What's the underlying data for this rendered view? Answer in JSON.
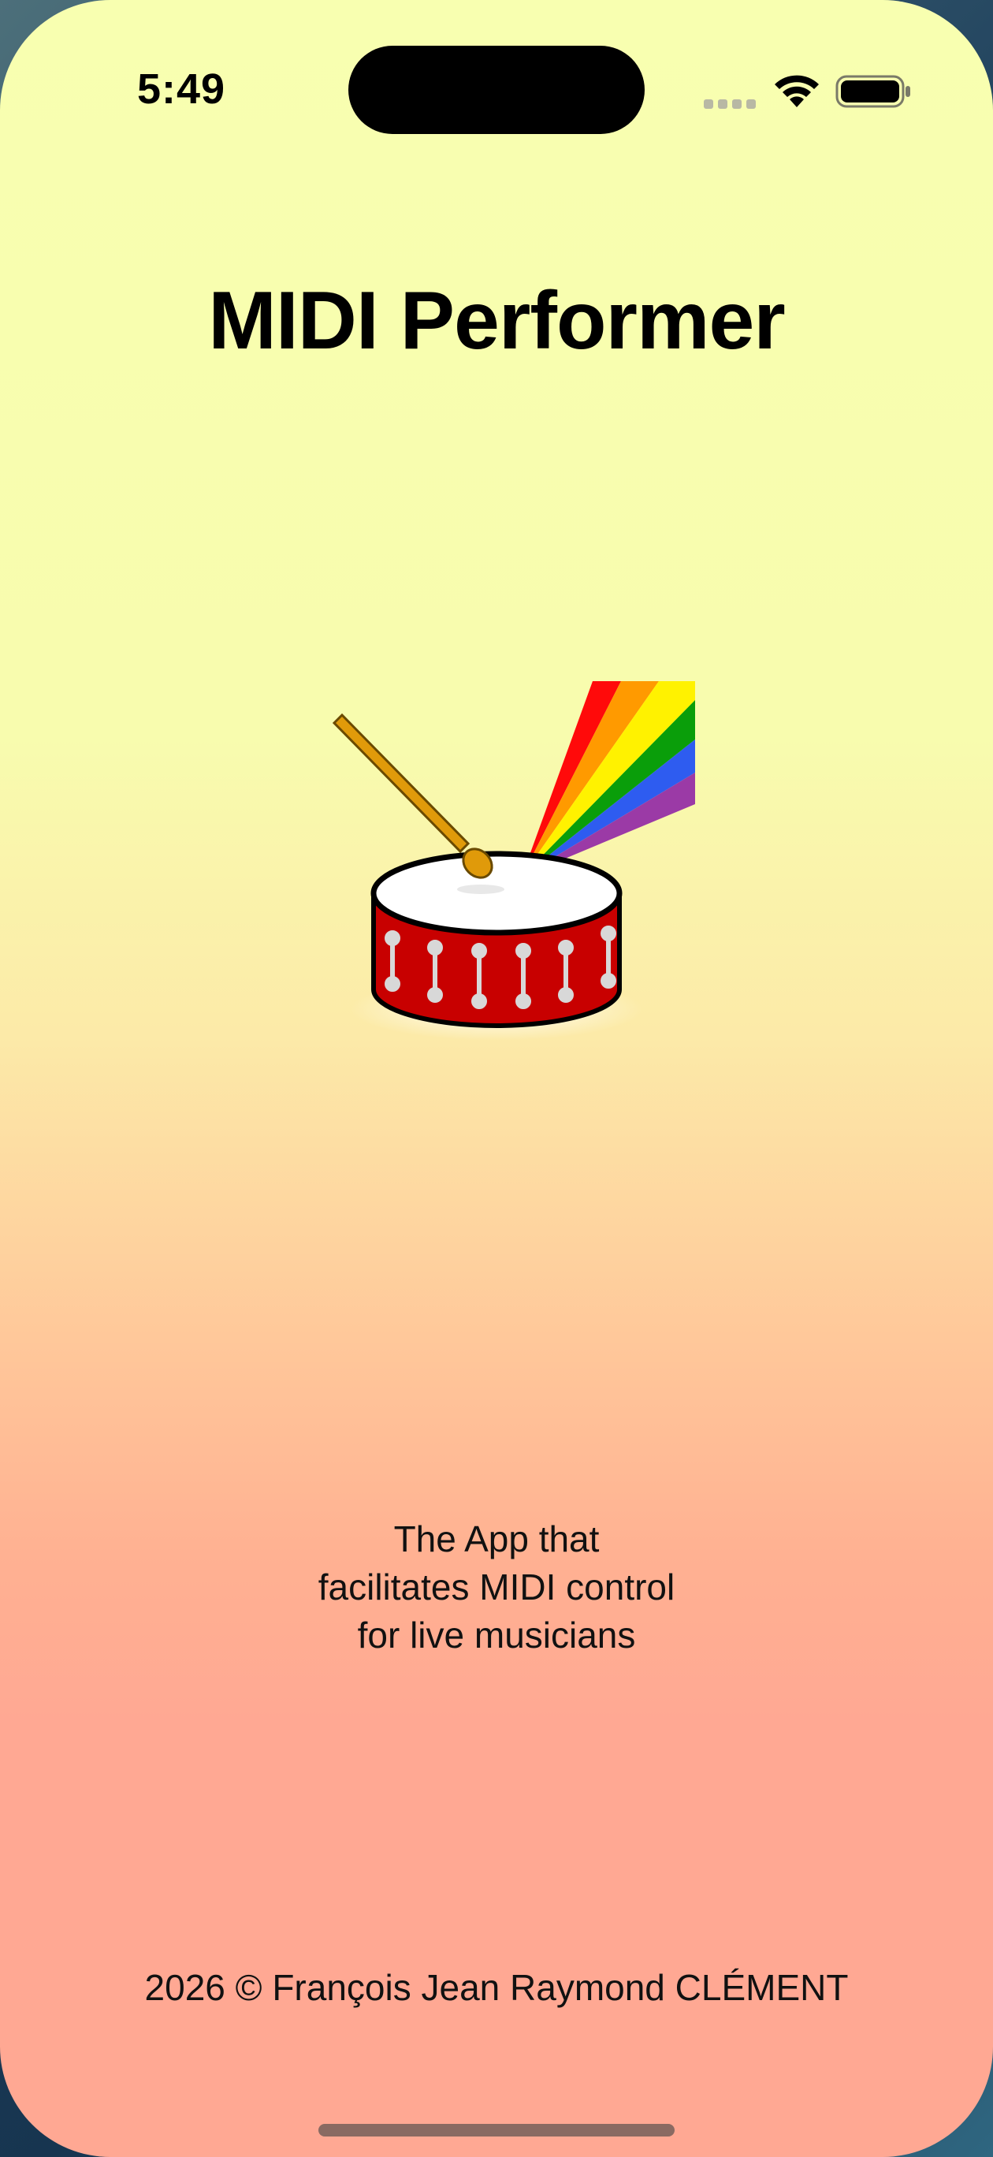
{
  "status_bar": {
    "time": "5:49",
    "signal_icon": "cellular-signal-icon",
    "wifi_icon": "wifi-icon",
    "battery_icon": "battery-icon"
  },
  "app": {
    "title": "MIDI Performer",
    "logo_icon": "drum-with-rainbow-logo",
    "tagline_lines": [
      "The App that",
      "facilitates MIDI control",
      "for live musicians"
    ],
    "copyright": "2026 © François Jean Raymond CLÉMENT"
  },
  "colors": {
    "background_top": "#f8ffb0",
    "background_bottom": "#ffa893",
    "drum_red": "#c80000",
    "rainbow": [
      "#ff0a0a",
      "#ff9a00",
      "#fff200",
      "#0a9e0a",
      "#2e5cf0",
      "#9b3aa6"
    ]
  }
}
